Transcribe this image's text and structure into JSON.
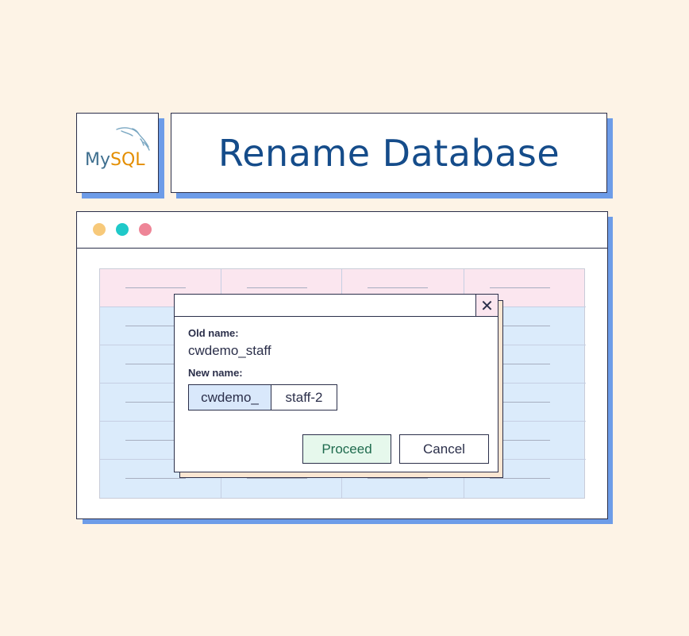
{
  "header": {
    "logo": {
      "text_my": "My",
      "text_sql": "SQL",
      "icon": "mysql-dolphin-icon"
    },
    "title": "Rename Database"
  },
  "window": {
    "traffic_lights": [
      {
        "name": "window-dot-yellow",
        "color": "#f7c97a"
      },
      {
        "name": "window-dot-teal",
        "color": "#1fc9c9"
      },
      {
        "name": "window-dot-pink",
        "color": "#ee8597"
      }
    ],
    "table": {
      "header_color": "#fbe6ef",
      "body_color": "#dbebfb",
      "columns": 4,
      "body_rows": 5
    }
  },
  "dialog": {
    "close_icon": "close-icon",
    "close_glyph": "✕",
    "old_name_label": "Old name:",
    "old_name_value": "cwdemo_staff",
    "new_name_label": "New name:",
    "new_name_prefix": "cwdemo_",
    "new_name_suffix": "staff-2",
    "proceed_label": "Proceed",
    "cancel_label": "Cancel"
  },
  "colors": {
    "background": "#fdf3e6",
    "title_blue": "#154c8a",
    "shadow_blue": "#6d9ce8",
    "border_dark": "#2b2f4a",
    "proceed_bg": "#e6f8ec"
  }
}
